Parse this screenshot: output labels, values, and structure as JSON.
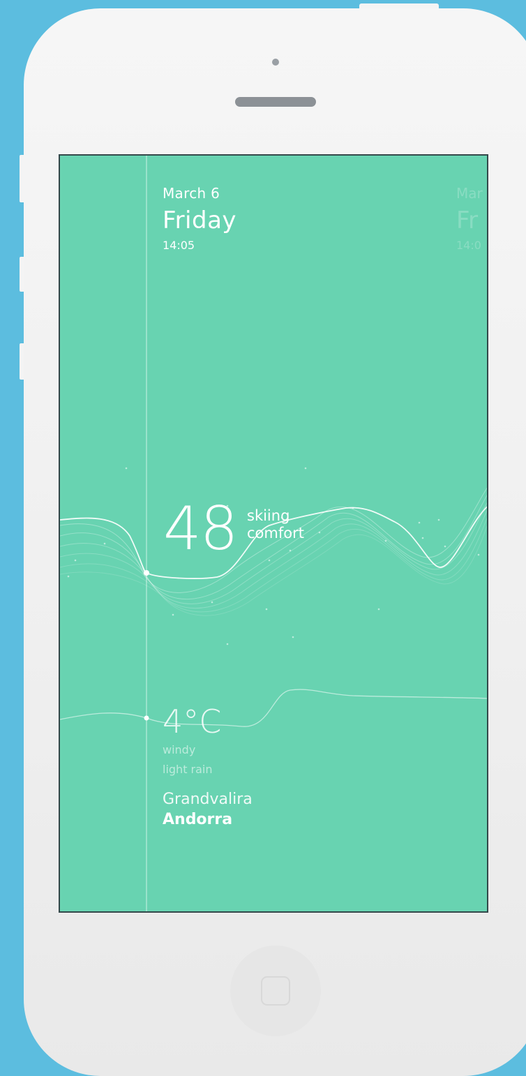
{
  "date": {
    "month_day": "March 6",
    "weekday": "Friday",
    "time": "14:05"
  },
  "next_day_preview": {
    "month_day": "Mar",
    "weekday": "Fr",
    "time": "14:0"
  },
  "skiing_comfort": {
    "value": "48",
    "label_line1": "skiing",
    "label_line2": "comfort"
  },
  "weather": {
    "temperature": "4°C",
    "condition1": "windy",
    "condition2": "light rain"
  },
  "location": {
    "resort": "Grandvalira",
    "country": "Andorra"
  },
  "colors": {
    "screen_bg": "#68d3b1",
    "background": "#5cbddf",
    "text": "#ffffff"
  }
}
